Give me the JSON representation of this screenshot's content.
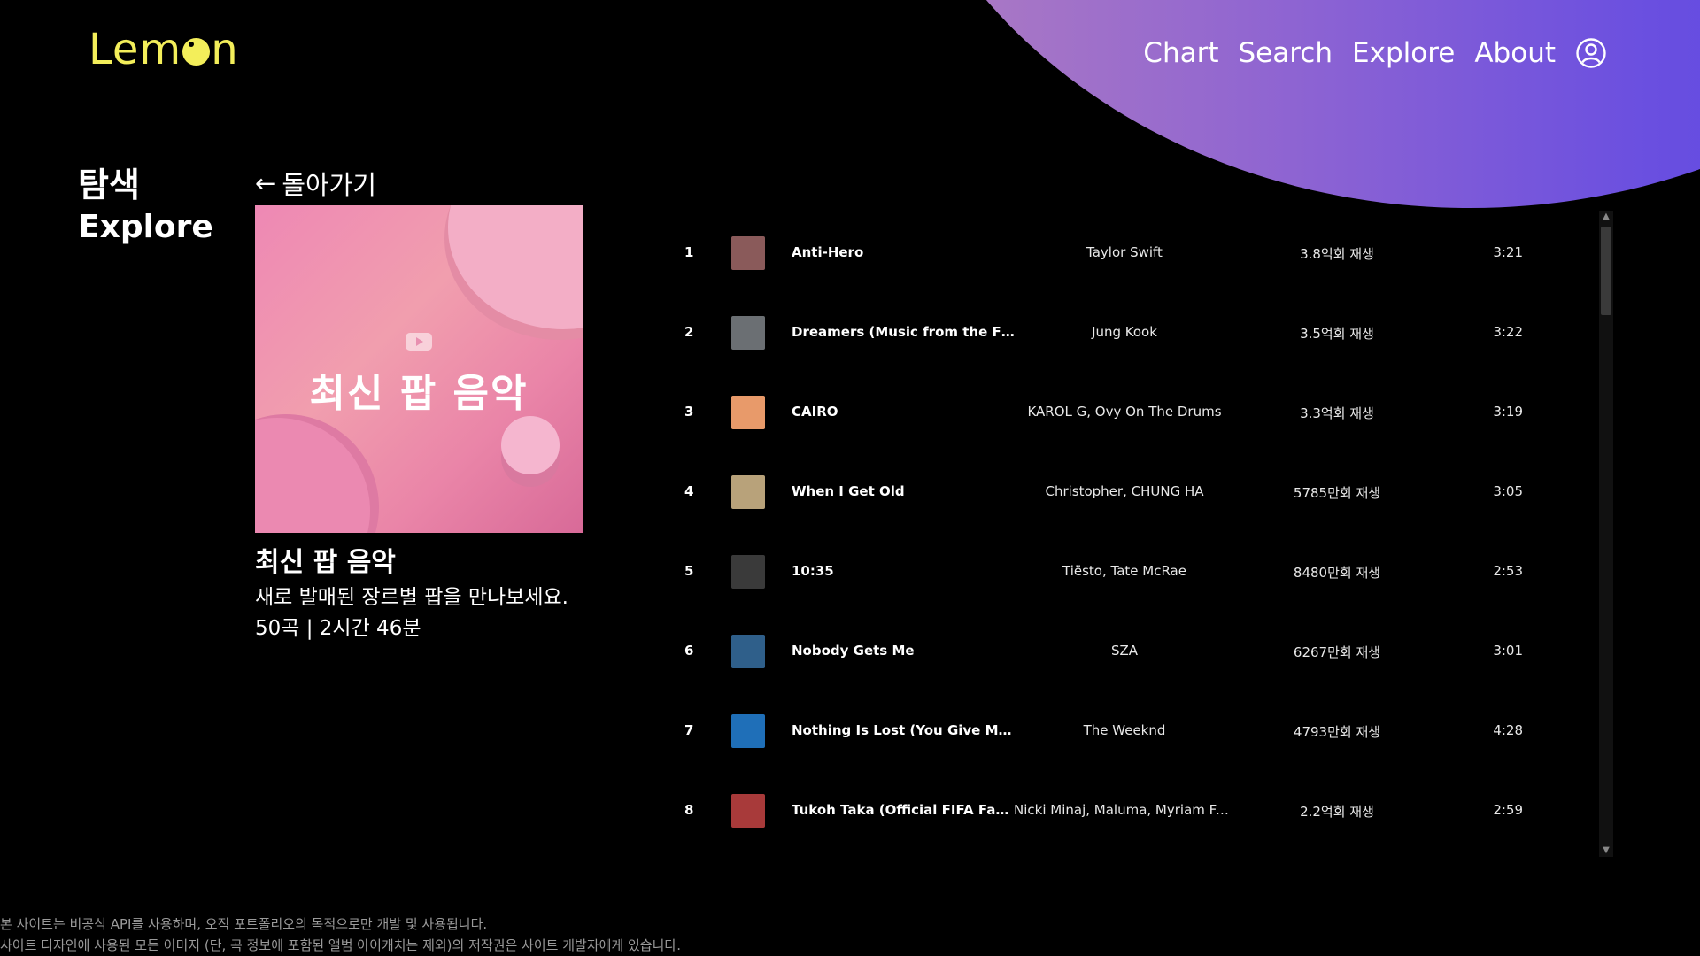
{
  "header": {
    "logo": {
      "before": "Lem",
      "after": "n"
    },
    "nav": [
      "Chart",
      "Search",
      "Explore",
      "About"
    ],
    "user_icon": "user-circle-icon"
  },
  "section": {
    "title_ko": "탐색",
    "title_en": "Explore"
  },
  "back": {
    "arrow": "←",
    "label": "돌아가기"
  },
  "playlist": {
    "cover_title": "최신 팝 음악",
    "title": "최신 팝 음악",
    "description": "새로 발매된 장르별 팝을 만나보세요.",
    "meta": "50곡 | 2시간 46분"
  },
  "tracks": [
    {
      "rank": "1",
      "title": "Anti-Hero",
      "artist": "Taylor Swift",
      "plays": "3.8억회 재생",
      "duration": "3:21",
      "color": "#8a5a5a"
    },
    {
      "rank": "2",
      "title": "Dreamers (Music from the FIFA...",
      "artist": "Jung Kook",
      "plays": "3.5억회 재생",
      "duration": "3:22",
      "color": "#6b6f73"
    },
    {
      "rank": "3",
      "title": "CAIRO",
      "artist": "KAROL G, Ovy On The Drums",
      "plays": "3.3억회 재생",
      "duration": "3:19",
      "color": "#e89a6a"
    },
    {
      "rank": "4",
      "title": "When I Get Old",
      "artist": "Christopher, CHUNG HA",
      "plays": "5785만회 재생",
      "duration": "3:05",
      "color": "#b8a27a"
    },
    {
      "rank": "5",
      "title": "10:35",
      "artist": "Tiësto, Tate McRae",
      "plays": "8480만회 재생",
      "duration": "2:53",
      "color": "#3a3a3a"
    },
    {
      "rank": "6",
      "title": "Nobody Gets Me",
      "artist": "SZA",
      "plays": "6267만회 재생",
      "duration": "3:01",
      "color": "#2f5f8a"
    },
    {
      "rank": "7",
      "title": "Nothing Is Lost (You Give Me St...",
      "artist": "The Weeknd",
      "plays": "4793만회 재생",
      "duration": "4:28",
      "color": "#1f6fb8"
    },
    {
      "rank": "8",
      "title": "Tukoh Taka (Official FIFA Fan F...",
      "artist": "Nicki Minaj, Maluma, Myriam Far...",
      "plays": "2.2억회 재생",
      "duration": "2:59",
      "color": "#a83a3a"
    }
  ],
  "scrollbar": {
    "up": "▲",
    "down": "▼"
  },
  "footer": {
    "line1": "본 사이트는 비공식 API를 사용하며, 오직 포트폴리오의 목적으로만 개발 및 사용됩니다.",
    "line2": "사이트 디자인에 사용된 모든 이미지 (단, 곡 정보에 포함된 앨범 아이캐치는 제외)의 저작권은 사이트 개발자에게 있습니다."
  },
  "colors": {
    "logo": "#f3ee5a",
    "background": "#000000",
    "blob_start": "#b27ec0",
    "blob_end": "#4e3fe6"
  }
}
